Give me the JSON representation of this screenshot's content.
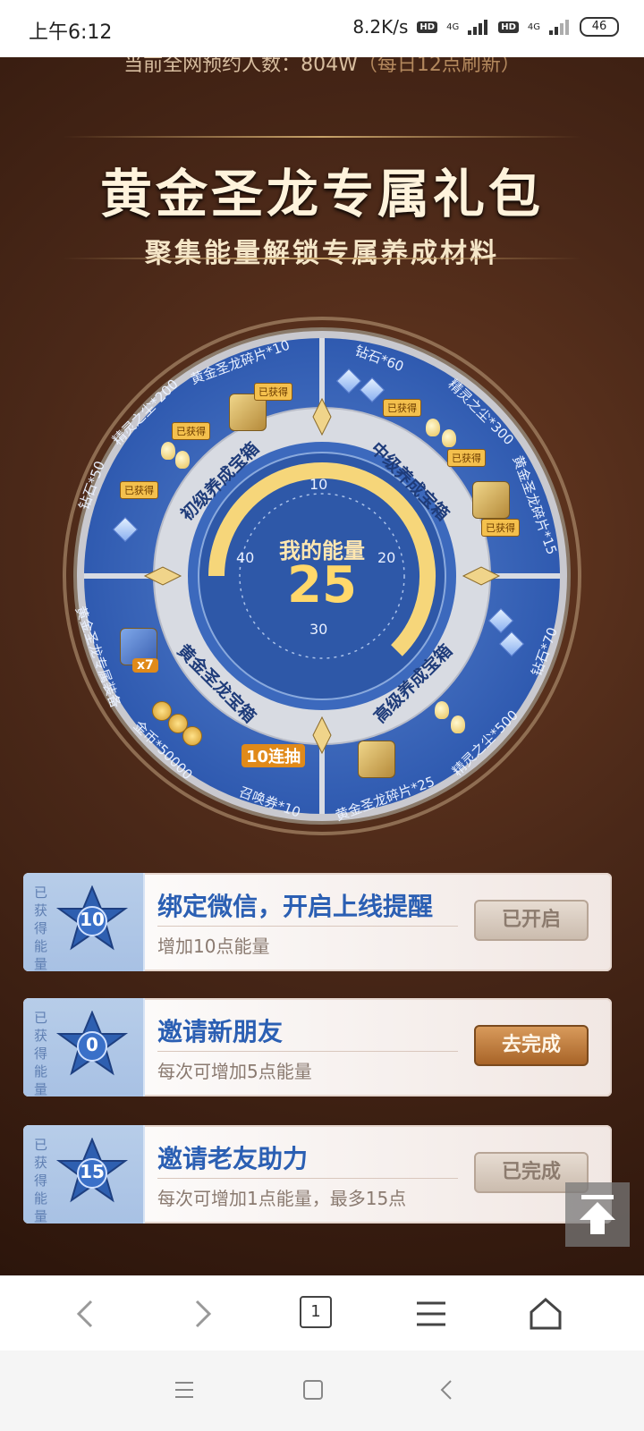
{
  "status_bar": {
    "time": "上午6:12",
    "network_speed": "8.2K/s",
    "hd_label": "HD",
    "signal_label": "4G",
    "battery": "46"
  },
  "banner": {
    "reservation_prefix": "当前全网预约人数：",
    "reservation_count": "804W",
    "refresh_note": "（每日12点刷新）",
    "title": "黄金圣龙专属礼包",
    "subtitle": "聚集能量解锁专属养成材料"
  },
  "wheel": {
    "energy_label": "我的能量",
    "energy_value": "25",
    "energy_progress_ratio": 0.625,
    "ticks": [
      "10",
      "20",
      "30",
      "40"
    ],
    "chests": {
      "beginner": "初级养成宝箱",
      "intermediate": "中级养成宝箱",
      "advanced": "高级养成宝箱",
      "golden_dragon": "黄金圣龙宝箱"
    },
    "rewards": {
      "beginner": [
        "钻石*50",
        "精灵之尘*200",
        "黄金圣龙碎片*10"
      ],
      "intermediate": [
        "钻石*60",
        "精灵之尘*300",
        "黄金圣龙碎片*15"
      ],
      "advanced": [
        "钻石*70",
        "精灵之尘*500",
        "黄金圣龙碎片*25"
      ],
      "golden_dragon": [
        "黄金圣龙专属装备",
        "金币*50000",
        "召唤券*10"
      ]
    },
    "obtained_badge": "已获得",
    "ten_draw_label": "10连抽",
    "equip_multiplier": "x7"
  },
  "tasks": [
    {
      "side_label": "已获得能量",
      "energy": "10",
      "title": "绑定微信，开启上线提醒",
      "desc": "增加10点能量",
      "button": "已开启",
      "state": "done"
    },
    {
      "side_label": "已获得能量",
      "energy": "0",
      "title": "邀请新朋友",
      "desc": "每次可增加5点能量",
      "button": "去完成",
      "state": "go"
    },
    {
      "side_label": "已获得能量",
      "energy": "15",
      "title": "邀请老友助力",
      "desc": "每次可增加1点能量，最多15点",
      "button": "已完成",
      "state": "done"
    }
  ],
  "browser_nav": {
    "tab_count": "1",
    "icons": [
      "back-icon",
      "forward-icon",
      "tabs-icon",
      "menu-icon",
      "home-icon"
    ]
  },
  "system_nav": {
    "icons": [
      "recents-icon",
      "home-square-icon",
      "back-chevron-icon"
    ]
  },
  "colors": {
    "gold": "#ffd86b",
    "blue_title": "#2b5fb3",
    "button_go": "#a86428",
    "button_done": "#cbbcae"
  }
}
